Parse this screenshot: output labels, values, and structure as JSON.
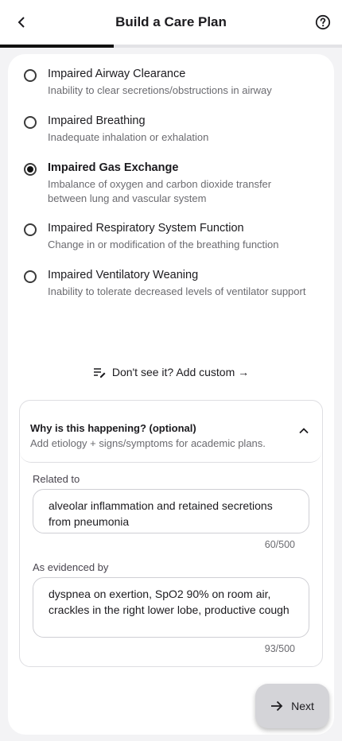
{
  "header": {
    "title": "Build a Care Plan",
    "back_icon": "back-arrow-icon",
    "help_icon": "help-circle-icon"
  },
  "progress": {
    "fraction": 0.333
  },
  "options": [
    {
      "title": "Impaired Airway Clearance",
      "description": "Inability to clear secretions/obstructions in airway",
      "selected": false
    },
    {
      "title": "Impaired Breathing",
      "description": "Inadequate inhalation or exhalation",
      "selected": false
    },
    {
      "title": "Impaired Gas Exchange",
      "description": "Imbalance of oxygen and carbon dioxide transfer between lung and vascular system",
      "selected": true
    },
    {
      "title": "Impaired Respiratory System Function",
      "description": "Change in or modification of the breathing function",
      "selected": false
    },
    {
      "title": "Impaired Ventilatory Weaning",
      "description": "Inability to tolerate decreased levels of ventilator support",
      "selected": false
    }
  ],
  "custom": {
    "label": "Don't see it? Add custom →",
    "icon": "edit-list-icon"
  },
  "why": {
    "title": "Why is this happening? (optional)",
    "subtitle": "Add etiology + signs/symptoms for academic plans.",
    "expanded": true,
    "related_to": {
      "label": "Related to",
      "value": "alveolar inflammation and retained secretions from pneumonia",
      "counter": "60/500"
    },
    "evidenced_by": {
      "label": "As evidenced by",
      "value": "dyspnea on exertion, SpO2 90% on room air, crackles in the right lower lobe, productive cough",
      "counter": "93/500"
    }
  },
  "next_button": {
    "label": "Next",
    "icon": "arrow-right-icon"
  },
  "colors": {
    "accent": "#111111",
    "button_bg": "#d4d4d8",
    "muted_text": "#6b6b70"
  }
}
